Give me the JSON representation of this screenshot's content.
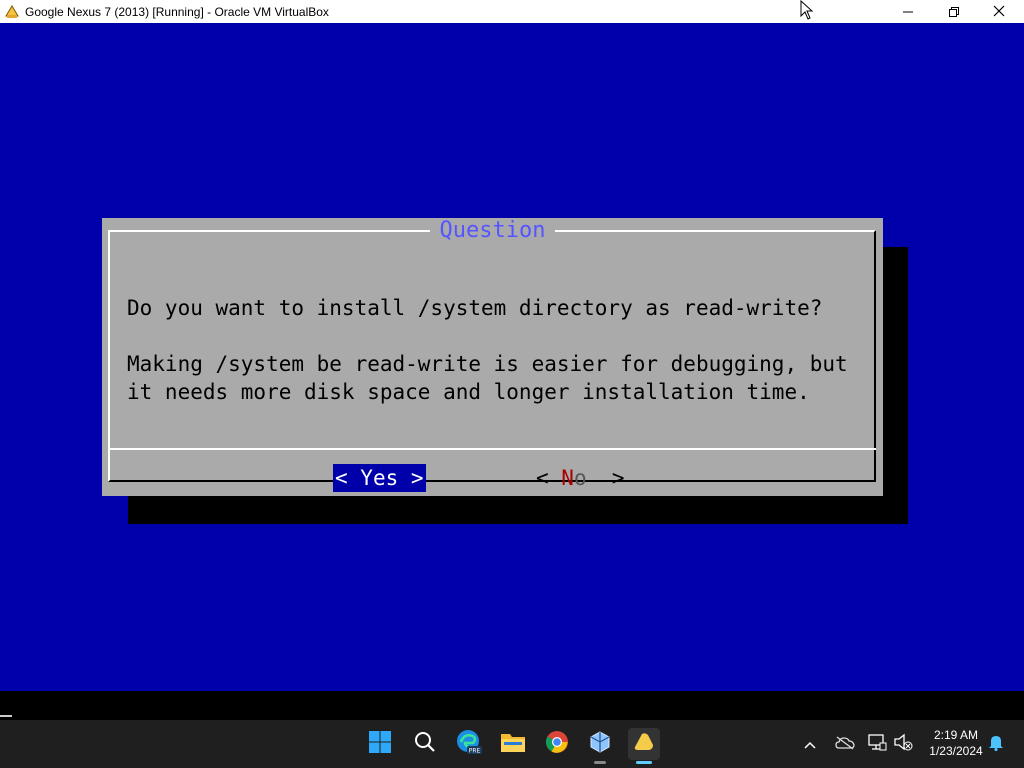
{
  "window": {
    "title": "Google Nexus 7 (2013) [Running] - Oracle VM VirtualBox",
    "icons": [
      "virtualbox-app-icon",
      "minimize-icon",
      "maximize-icon",
      "close-icon"
    ]
  },
  "dialog": {
    "title": "Question",
    "question": "Do you want to install /system directory as read-write?",
    "description_line1": "Making /system be read-write is easier for debugging, but",
    "description_line2": "it needs more disk space and longer installation time.",
    "yes_button": {
      "left": "< ",
      "hotkey": "Y",
      "rest": "es",
      "right": " >"
    },
    "no_button": {
      "left": "< ",
      "hotkey": "N",
      "rest": "o",
      "right": "  >"
    },
    "selected": "Yes"
  },
  "taskbar": {
    "apps": [
      "windows-start-icon",
      "search-icon",
      "edge-pre-icon",
      "file-explorer-icon",
      "chrome-icon",
      "virtualbox-icon",
      "vm-window-icon"
    ],
    "active_app": "vm-window-icon",
    "tray_icons": [
      "chevron-up-icon",
      "onedrive-off-icon",
      "network-icon",
      "volume-mute-icon",
      "notification-bell-icon"
    ],
    "time": "2:19 AM",
    "date": "1/23/2024"
  },
  "colors": {
    "vm_background": "#0000aa",
    "dialog_background": "#aaaaaa",
    "dialog_title": "#5555ff",
    "hotkey_no": "#aa0000"
  }
}
